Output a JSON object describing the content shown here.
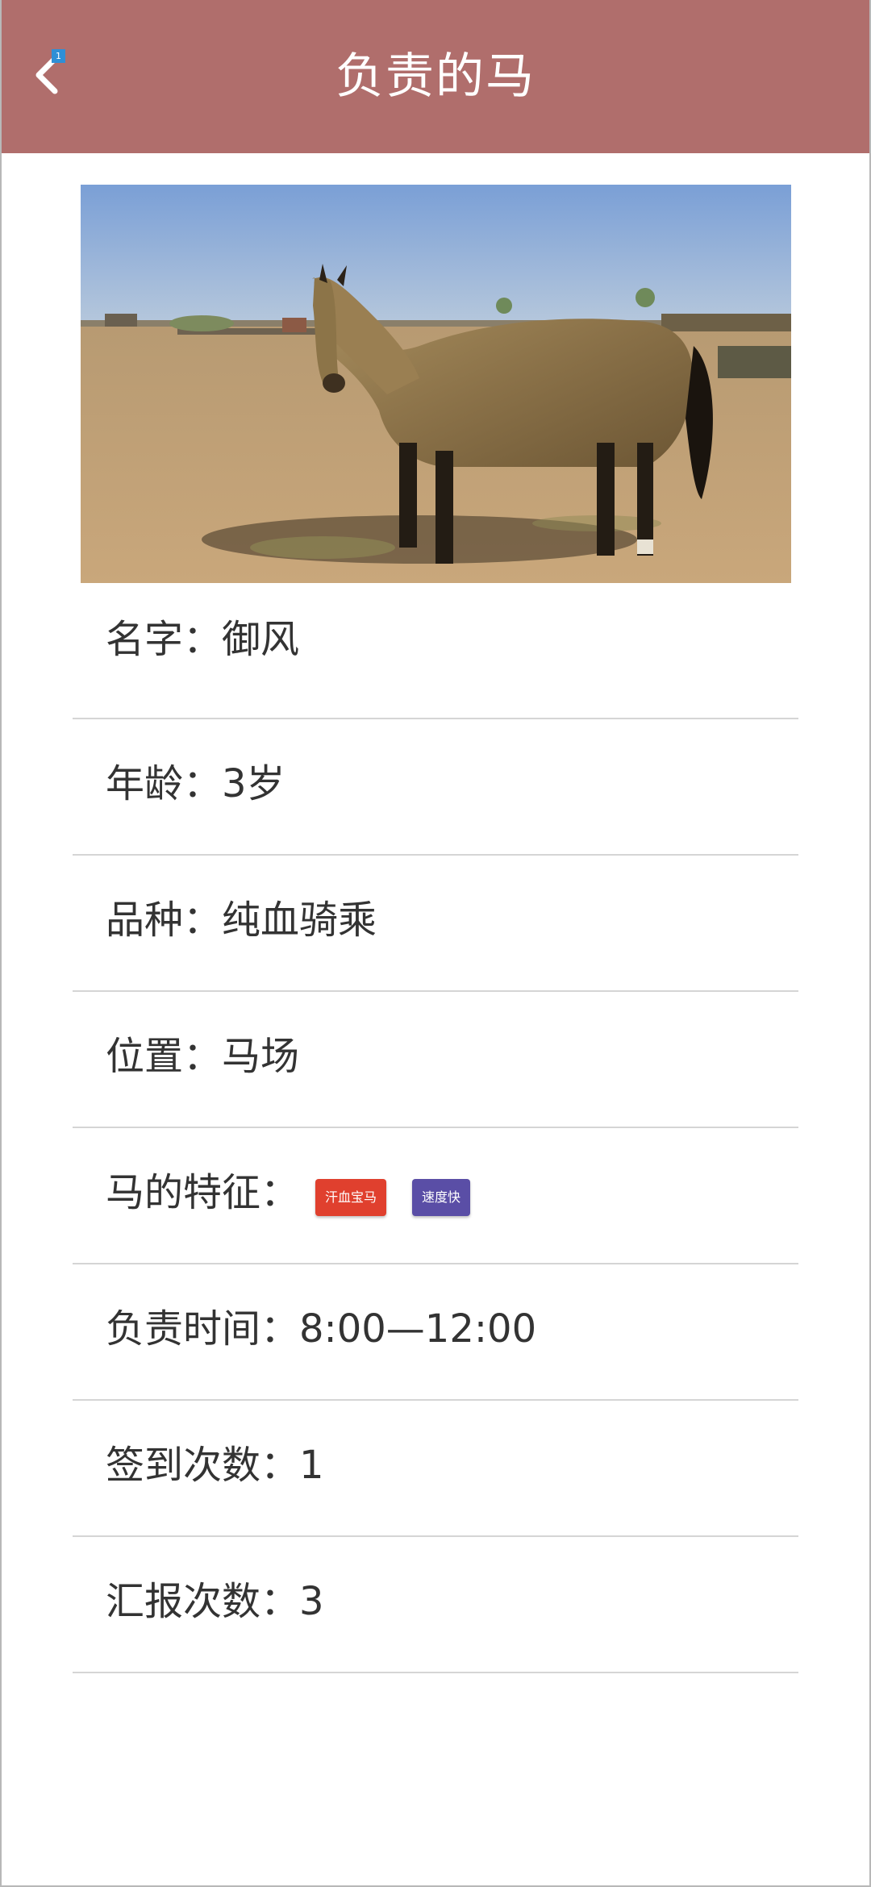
{
  "header": {
    "title": "负责的马",
    "back_badge": "1",
    "background_color": "#b06e6c"
  },
  "photo": {
    "alt": "horse"
  },
  "info": {
    "name": "名字：御风",
    "age": "年龄：3岁",
    "breed": "品种：纯血骑乘",
    "location": "位置：马场",
    "features_label": "马的特征：",
    "features": [
      {
        "label": "汗血宝马",
        "color": "#e0402e"
      },
      {
        "label": "速度快",
        "color": "#5a4ea6"
      }
    ],
    "duty_time": "负责时间：8:00—12:00",
    "checkin_count": "签到次数：1",
    "report_count": "汇报次数：3"
  }
}
